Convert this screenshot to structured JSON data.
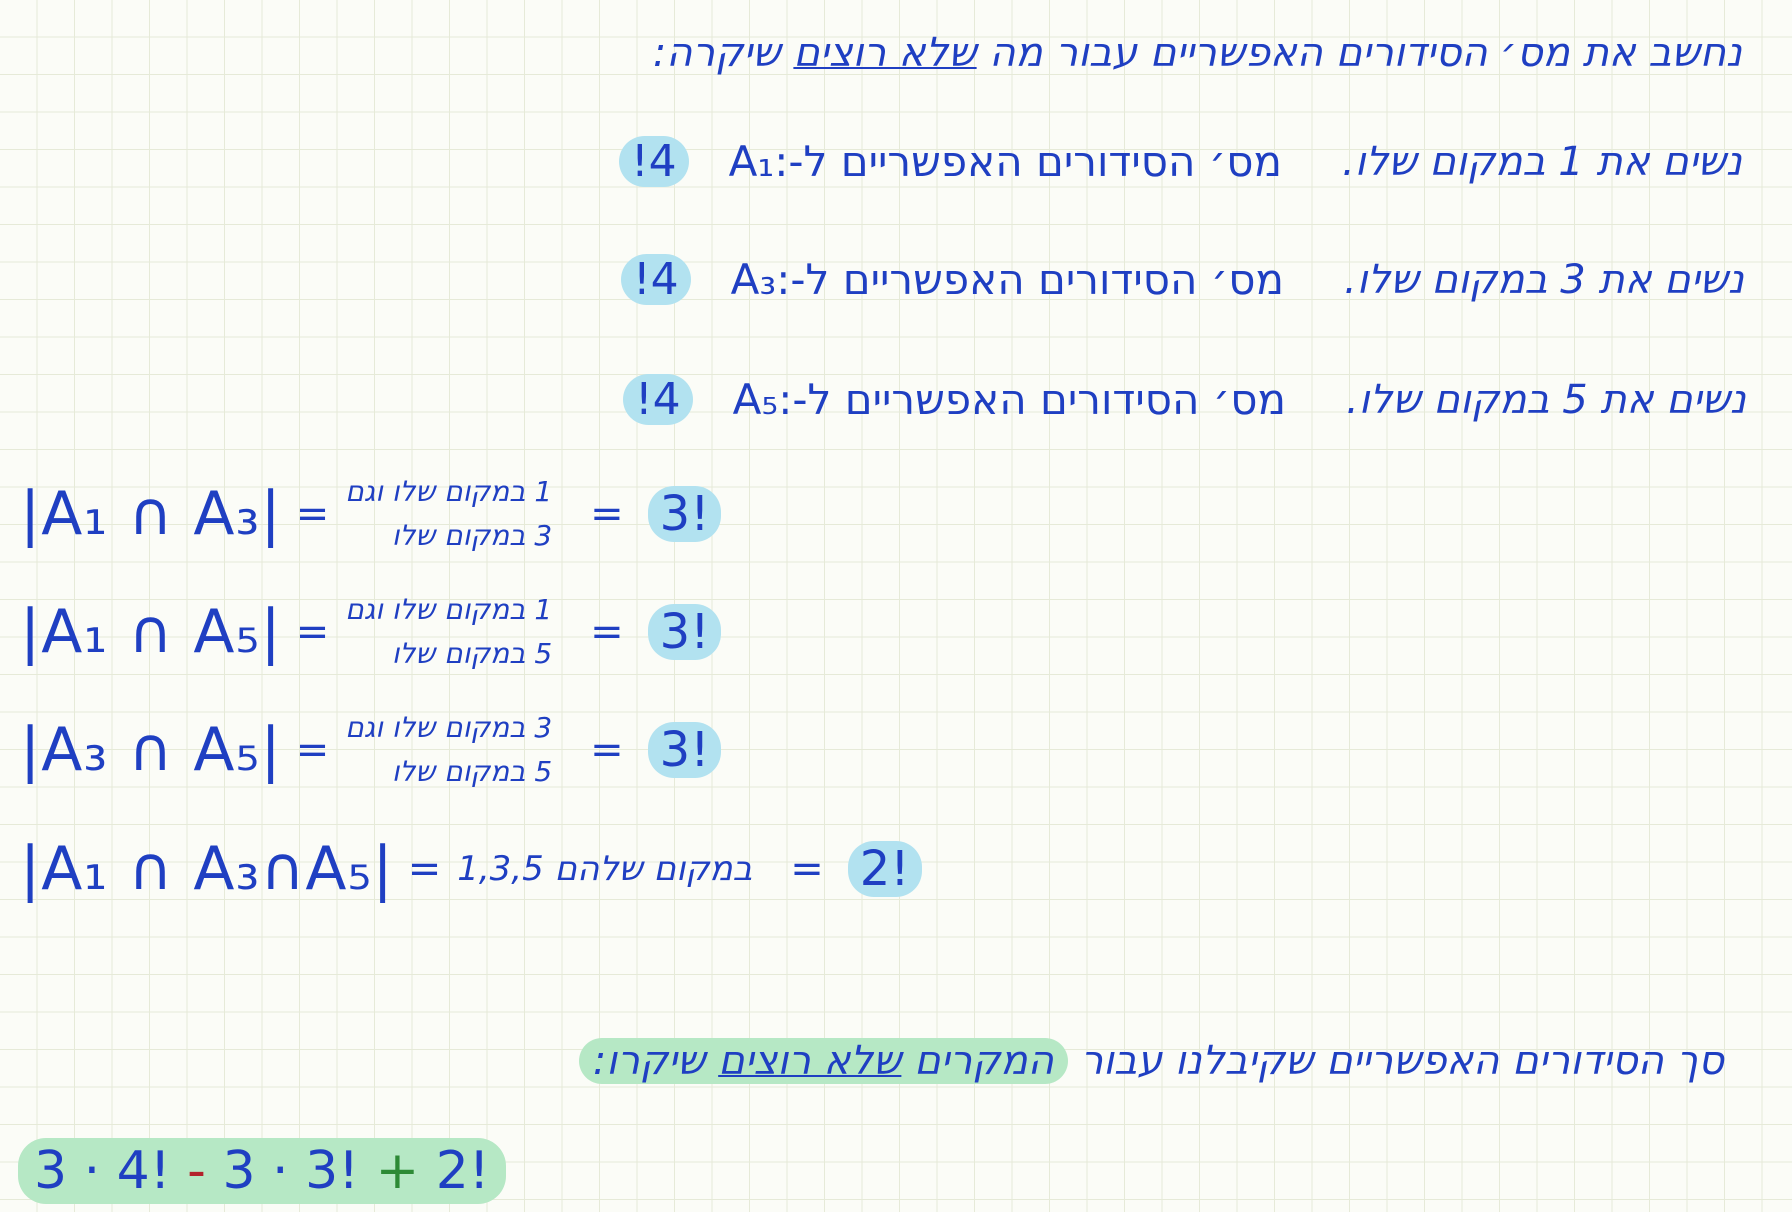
{
  "intro": {
    "text_before": "נחשב את מס׳ הסידורים האפשריים עבור מה",
    "underlined": "שלא רוצים",
    "text_after": "שיקרה:"
  },
  "rules": [
    {
      "desc": "נשים את 1 במקום שלו.",
      "count": "מס׳ הסידורים האפשריים ל-",
      "set": "A₁:",
      "answer": "4!"
    },
    {
      "desc": "נשים את 3 במקום שלו.",
      "count": "מס׳ הסידורים האפשריים ל-",
      "set": "A₃:",
      "answer": "4!"
    },
    {
      "desc": "נשים את 5 במקום שלו.",
      "count": "מס׳ הסידורים האפשריים ל-",
      "set": "A₅:",
      "answer": "4!"
    }
  ],
  "intersections": [
    {
      "lhs": "|A₁ ∩ A₃|",
      "eq": "=",
      "line1": "1 במקום שלו וגם",
      "line2": "3 במקום שלו",
      "eq2": "=",
      "value": "3!"
    },
    {
      "lhs": "|A₁ ∩ A₅|",
      "eq": "=",
      "line1": "1 במקום שלו וגם",
      "line2": "5 במקום שלו",
      "eq2": "=",
      "value": "3!"
    },
    {
      "lhs": "|A₃ ∩ A₅|",
      "eq": "=",
      "line1": "3 במקום שלו וגם",
      "line2": "5 במקום שלו",
      "eq2": "=",
      "value": "3!"
    }
  ],
  "triple": {
    "lhs": "|A₁ ∩ A₃∩A₅|",
    "eq": "=",
    "desc": "במקום שלהם 1,3,5",
    "eq2": "=",
    "value": "2!"
  },
  "summary": {
    "text_before": "סך הסידורים האפשריים שקיבלנו עבור",
    "hl_before": "המקרים",
    "hl_underlined": "שלא רוצים",
    "hl_after": "שיקרו:"
  },
  "formula": {
    "t1": "3 · 4!",
    "op1": "-",
    "t2": "3 · 3!",
    "op2": "+",
    "t3": "2!"
  }
}
